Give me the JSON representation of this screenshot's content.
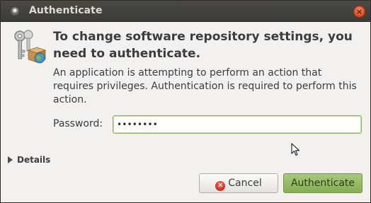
{
  "titlebar": {
    "title": "Authenticate",
    "close_glyph": "×"
  },
  "dialog": {
    "headline": "To change software repository settings, you need to authenticate.",
    "description": "An application is attempting to perform an action that requires privileges. Authentication is required to perform this action.",
    "icon": "keys-package-icon",
    "password": {
      "label": "Password:",
      "value": "••••••••"
    },
    "details_label": "Details"
  },
  "buttons": {
    "cancel_label": "Cancel",
    "authenticate_label": "Authenticate"
  },
  "colors": {
    "titlebar": "#3c3b37",
    "close_button": "#e0542b",
    "authenticate_button": "#86ae53",
    "focus_ring": "#8fb15e"
  }
}
